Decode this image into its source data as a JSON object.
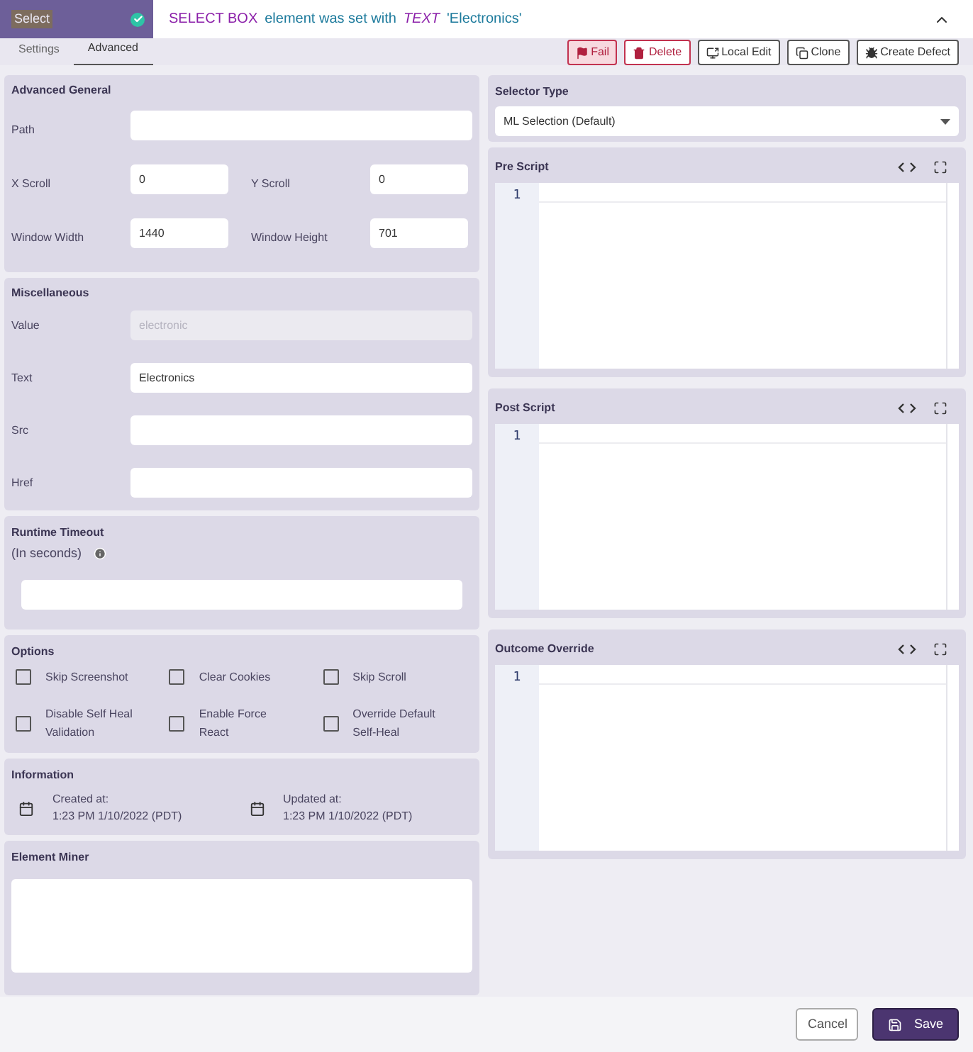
{
  "header": {
    "step": "Select",
    "passed": true,
    "message": [
      {
        "kind": "keyword",
        "text": "SELECT BOX"
      },
      {
        "kind": "plain",
        "text": "element was set with"
      },
      {
        "kind": "emphasis",
        "text": "TEXT"
      },
      {
        "kind": "plain",
        "text": "'Electronics'"
      }
    ]
  },
  "tabs": [
    {
      "label": "Settings",
      "selected": false
    },
    {
      "label": "Advanced",
      "selected": true
    }
  ],
  "actions": [
    {
      "kind": "fail",
      "label": "Fail"
    },
    {
      "kind": "delete",
      "label": "Delete"
    },
    {
      "kind": "local_edit",
      "label": "Local Edit"
    },
    {
      "kind": "clone",
      "label": "Clone"
    },
    {
      "kind": "create_defect",
      "label": "Create Defect"
    }
  ],
  "advanced_general": {
    "title": "Advanced General",
    "rows": [
      [
        {
          "label": "Path"
        }
      ],
      [
        {
          "label": "X Scroll",
          "value": "0"
        },
        {
          "label": "Y Scroll",
          "value": "0"
        }
      ],
      [
        {
          "label": "Window Width",
          "value": "1440"
        },
        {
          "label": "Window Height",
          "value": "701"
        }
      ]
    ]
  },
  "miscellaneous": {
    "title": "Miscellaneous",
    "fields": [
      {
        "label": "Value",
        "value": "electronic",
        "disabled": true
      },
      {
        "label": "Text",
        "value": "Electronics",
        "disabled": false
      },
      {
        "label": "Src",
        "disabled": false
      },
      {
        "label": "Href",
        "disabled": false
      }
    ]
  },
  "runtime_timeout": {
    "title": "Runtime Timeout",
    "subtitle": "(In seconds)"
  },
  "options": {
    "title": "Options",
    "items": [
      {
        "label": "Skip Screenshot",
        "checked": false
      },
      {
        "label": "Clear Cookies",
        "checked": false
      },
      {
        "label": "Skip Scroll",
        "checked": false
      },
      {
        "label": "Disable Self Heal Validation",
        "checked": false
      },
      {
        "label": "Enable Force React",
        "checked": false
      },
      {
        "label": "Override Default Self-Heal",
        "checked": false
      }
    ]
  },
  "information": {
    "title": "Information",
    "items": [
      {
        "label": "Created at:",
        "value": "1:23 PM 1/10/2022 (PDT)"
      },
      {
        "label": "Updated at:",
        "value": "1:23 PM 1/10/2022 (PDT)"
      }
    ]
  },
  "element_miner": {
    "title": "Element Miner"
  },
  "selector_type": {
    "title": "Selector Type",
    "value": "ML Selection (Default)"
  },
  "editors": [
    {
      "title": "Pre Script",
      "line": "1"
    },
    {
      "title": "Post Script",
      "line": "1"
    },
    {
      "title": "Outcome Override",
      "line": "1"
    }
  ],
  "footer": [
    {
      "kind": "secondary",
      "label": "Cancel"
    },
    {
      "kind": "primary",
      "label": "Save"
    }
  ]
}
